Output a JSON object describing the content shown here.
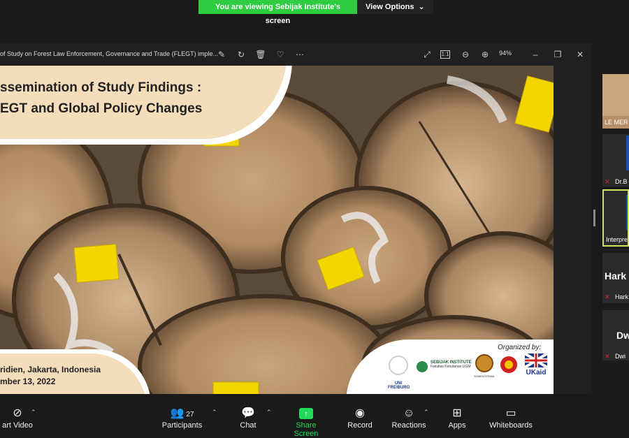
{
  "banner": {
    "viewing_text": "You are viewing Sebijak Institute's screen",
    "options_label": "View Options"
  },
  "viewer": {
    "doc_title": "of Study on Forest Law Enforcement, Governance and Trade (FLEGT) imple...",
    "zoom": "94%"
  },
  "slide": {
    "title_line1": "ssemination of Study Findings :",
    "title_line2": "EGT and Global Policy Changes",
    "venue_line1": "ridien, Jakarta, Indonesia",
    "venue_line2": "mber 13, 2022",
    "organized_by": "Organized by:",
    "logos": [
      "UNI FREIBURG",
      "SEBIJAK INSTITUTE",
      "Fakultas Kehutanan UGM",
      "KEMENTERIAN",
      "UKaid"
    ]
  },
  "participants_panel": {
    "tiles": [
      {
        "caption": "LE MER"
      },
      {
        "caption": "Dr.B"
      },
      {
        "caption": "Interpre"
      },
      {
        "big": "Hark",
        "caption": "Hark"
      },
      {
        "big": "Dw",
        "caption": "Dwi"
      }
    ]
  },
  "toolbar": {
    "start_video": "art Video",
    "participants": "Participants",
    "participants_count": "27",
    "chat": "Chat",
    "share_screen": "Share Screen",
    "record": "Record",
    "reactions": "Reactions",
    "apps": "Apps",
    "whiteboards": "Whiteboards"
  },
  "colors": {
    "share_green": "#23d959",
    "banner_green": "#2ecc40",
    "mic_red": "#e02828",
    "slide_beige": "#f3ddbb"
  }
}
